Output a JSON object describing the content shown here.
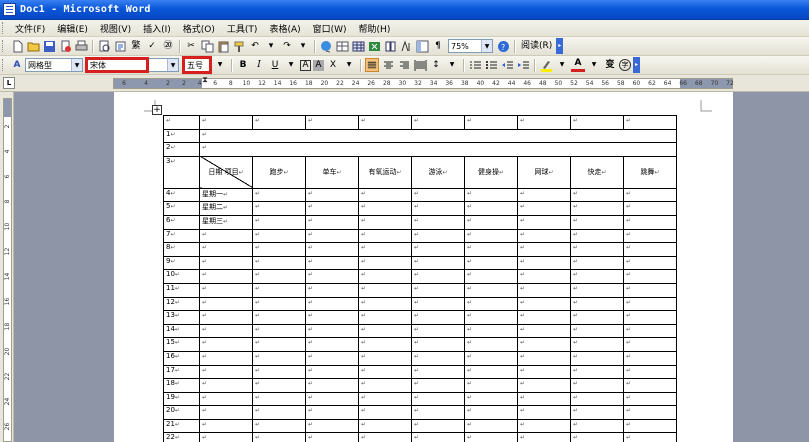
{
  "window": {
    "title": "Doc1 - Microsoft Word"
  },
  "menubar": {
    "items": [
      "文件(F)",
      "编辑(E)",
      "视图(V)",
      "插入(I)",
      "格式(O)",
      "工具(T)",
      "表格(A)",
      "窗口(W)",
      "帮助(H)"
    ]
  },
  "standard_toolbar": {
    "zoom": "75%",
    "reading_mode": "阅读(R)"
  },
  "format_toolbar": {
    "style": "网格型",
    "font_name": "宋体",
    "font_size": "五号",
    "bold": "B",
    "italic": "I",
    "underline": "U"
  },
  "ruler": {
    "ticks": [
      "6",
      "4",
      "2",
      "2",
      "4",
      "6",
      "8",
      "10",
      "12",
      "14",
      "16",
      "18",
      "20",
      "22",
      "24",
      "26",
      "28",
      "30",
      "32",
      "34",
      "36",
      "38",
      "40",
      "42",
      "44",
      "46",
      "48",
      "50",
      "52",
      "54",
      "56",
      "58",
      "60",
      "62",
      "64",
      "66",
      "68",
      "70",
      "72"
    ]
  },
  "vruler": {
    "ticks": [
      "2",
      "4",
      "6",
      "8",
      "10",
      "12",
      "14",
      "16",
      "18",
      "20",
      "22",
      "24",
      "26"
    ]
  },
  "table": {
    "header": {
      "diag_top": "项目",
      "diag_bottom": "日期",
      "columns": [
        "跑步",
        "单车",
        "有氧运动",
        "游泳",
        "健身操",
        "网球",
        "快走",
        "跳舞"
      ]
    },
    "rows": [
      {
        "n": "1",
        "label": ""
      },
      {
        "n": "2",
        "label": ""
      },
      {
        "n": "4",
        "label": "星期一"
      },
      {
        "n": "5",
        "label": "星期二"
      },
      {
        "n": "6",
        "label": "星期三"
      },
      {
        "n": "7",
        "label": ""
      },
      {
        "n": "8",
        "label": ""
      },
      {
        "n": "9",
        "label": ""
      },
      {
        "n": "10",
        "label": ""
      },
      {
        "n": "11",
        "label": ""
      },
      {
        "n": "12",
        "label": ""
      },
      {
        "n": "13",
        "label": ""
      },
      {
        "n": "14",
        "label": ""
      },
      {
        "n": "15",
        "label": ""
      },
      {
        "n": "16",
        "label": ""
      },
      {
        "n": "17",
        "label": ""
      },
      {
        "n": "18",
        "label": ""
      },
      {
        "n": "19",
        "label": ""
      },
      {
        "n": "20",
        "label": ""
      },
      {
        "n": "21",
        "label": ""
      },
      {
        "n": "22",
        "label": ""
      }
    ],
    "header_row_num": "3",
    "mark": "↵"
  },
  "colors": {
    "titlebar": "#0a58d8",
    "highlight": "#d61f1f",
    "workspace": "#8e95a6"
  }
}
